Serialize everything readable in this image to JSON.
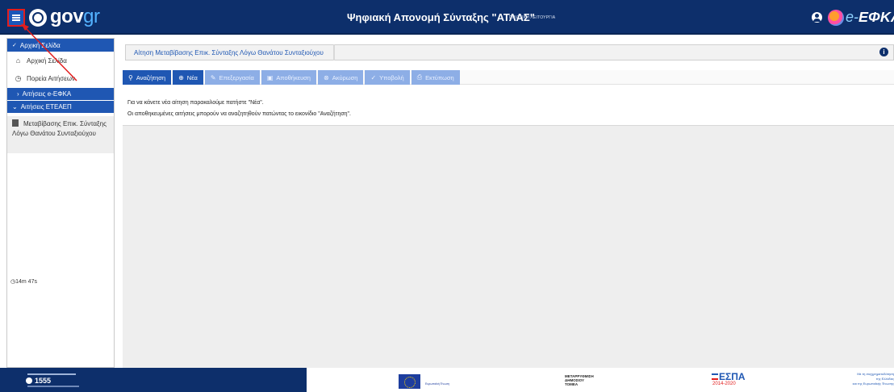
{
  "header": {
    "logo_text": "gov",
    "logo_suffix": "gr",
    "app_title": "Ψηφιακή Απονομή Σύνταξης \"ΑΤΛΑΣ\"",
    "app_mode": "ΠΙΛΟΤΙΚΗ ΛΕΙΤΟΥΡΓΙΑ",
    "brand_prefix": "e-",
    "brand_name": "ΕΦΚΑ"
  },
  "sidebar": {
    "home_header": "Αρχική Σελίδα",
    "home_item": "Αρχική Σελίδα",
    "history_item": "Πορεία Αιτήσεων",
    "efka_group": "Αιτήσεις e-ΕΦΚΑ",
    "eteaep_group": "Αιτήσεις ΕΤΕΑΕΠ",
    "doc_item": "Μεταβίβασης Επικ. Σύνταξης Λόγω Θανάτου Συνταξιούχου",
    "timer": "14m 47s"
  },
  "main": {
    "panel_title": "Αίτηση Μεταβίβασης Επικ. Σύνταξης Λόγω Θανάτου Συνταξιούχου",
    "toolbar": {
      "search": "Αναζήτηση",
      "new": "Νέα",
      "edit": "Επεξεργασία",
      "save": "Αποθήκευση",
      "cancel": "Ακύρωση",
      "submit": "Υποβολή",
      "print": "Εκτύπωση"
    },
    "message_1": "Για να κάνετε νέα αίτηση παρακαλούμε πατήστε \"Νέα\".",
    "message_2": "Οι αποθηκευμένες αιτήσεις μπορούν να αναζητηθούν πατώντας το εικονίδιο \"Αναζήτηση\"."
  },
  "footer": {
    "helpline": "1555",
    "eu_label": "Ευρωπαϊκή Ένωση",
    "reform_line1": "ΜΕΤΑΡΡΥΘΜΙΣΗ",
    "reform_line2": "ΔΗΜΟΣΙΟΥ",
    "reform_line3": "ΤΟΜΕΑ",
    "espa_name": "ΕΣΠΑ",
    "espa_years": "2014-2020",
    "cofund_1": "Με τη συγχρηματοδότηση",
    "cofund_2": "της Ελλάδας",
    "cofund_3": "και της Ευρωπαϊκής Ένωσης"
  },
  "colors": {
    "header_bg": "#0d2f6b",
    "accent": "#1f57b3",
    "disabled": "#8daee6",
    "annotation": "#e21d1d"
  }
}
